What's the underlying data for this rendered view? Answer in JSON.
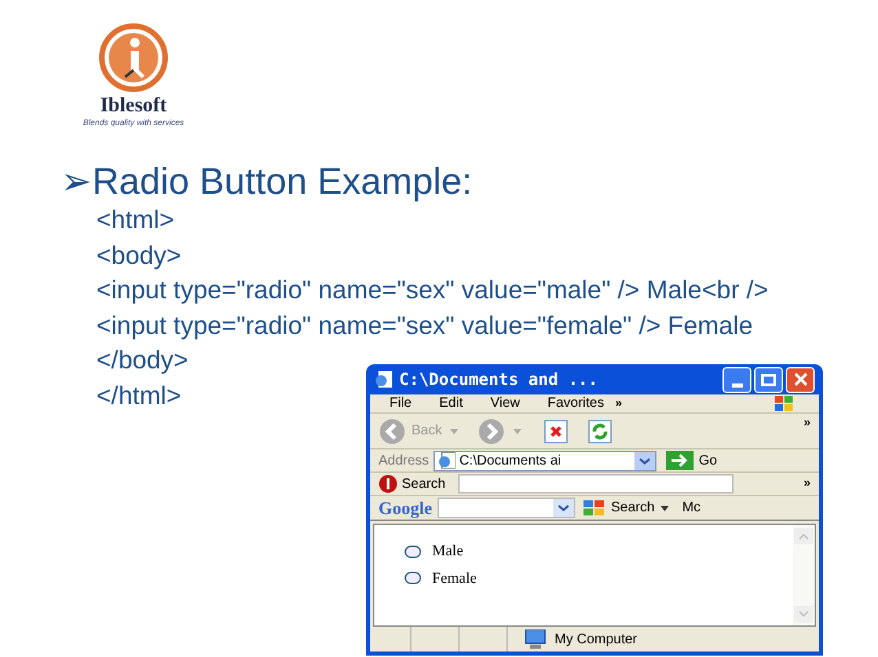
{
  "logo": {
    "name": "Iblesoft",
    "tagline": "Blends quality with services"
  },
  "heading": {
    "bullet": "➢",
    "text": "Radio Button Example:"
  },
  "code_lines": [
    "<html>",
    "<body>",
    "<input type=\"radio\" name=\"sex\" value=\"male\" /> Male<br />",
    "<input type=\"radio\" name=\"sex\" value=\"female\" /> Female",
    "</body>",
    "</html>"
  ],
  "browser": {
    "title": "C:\\Documents and ...",
    "menu": [
      "File",
      "Edit",
      "View",
      "Favorites"
    ],
    "menu_overflow": "»",
    "toolbar": {
      "back": "Back",
      "overflow": "»"
    },
    "address": {
      "label": "Address",
      "value": "C:\\Documents ai",
      "go": "Go"
    },
    "search_bar": {
      "label": "Search",
      "overflow": "»"
    },
    "google_bar": {
      "logo": "Google",
      "search": "Search",
      "more": "Mc"
    },
    "radios": [
      {
        "label": "Male",
        "selected": false
      },
      {
        "label": "Female",
        "selected": false
      }
    ],
    "status": "My Computer"
  }
}
